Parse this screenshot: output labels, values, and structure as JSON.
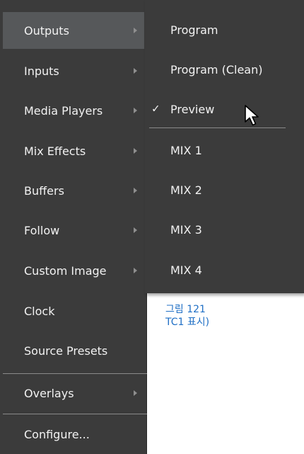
{
  "main_menu": {
    "items": [
      {
        "label": "Outputs",
        "has_submenu": true,
        "active": true
      },
      {
        "label": "Inputs",
        "has_submenu": true
      },
      {
        "label": "Media Players",
        "has_submenu": true
      },
      {
        "label": "Mix Effects",
        "has_submenu": true
      },
      {
        "label": "Buffers",
        "has_submenu": true
      },
      {
        "label": "Follow",
        "has_submenu": true
      },
      {
        "label": "Custom Image",
        "has_submenu": true
      },
      {
        "label": "Clock",
        "has_submenu": false
      },
      {
        "label": "Source Presets",
        "has_submenu": false
      },
      {
        "label": "Overlays",
        "has_submenu": true
      },
      {
        "label": "Configure...",
        "has_submenu": false
      }
    ]
  },
  "outputs_submenu": {
    "items": [
      {
        "label": "Program",
        "checked": false
      },
      {
        "label": "Program (Clean)",
        "checked": false
      },
      {
        "label": "Preview",
        "checked": true,
        "check_mark": "✓"
      },
      {
        "label": "MIX 1",
        "checked": false
      },
      {
        "label": "MIX 2",
        "checked": false
      },
      {
        "label": "MIX 3",
        "checked": false
      },
      {
        "label": "MIX 4",
        "checked": false
      }
    ]
  },
  "caption": {
    "line1": "그림 121",
    "line2": "TC1 표시)"
  },
  "colors": {
    "menu_background": "#3b3b3b",
    "menu_active": "#56585a",
    "menu_text": "#f2f2f2",
    "separator": "#8a8a8a",
    "submenu_arrow": "#8f8f8f",
    "caption_text": "#1f6fc5"
  },
  "icons": {
    "submenu_arrow": "triangle-right-icon",
    "checkmark": "checkmark-icon",
    "pointer": "mouse-pointer-icon"
  }
}
